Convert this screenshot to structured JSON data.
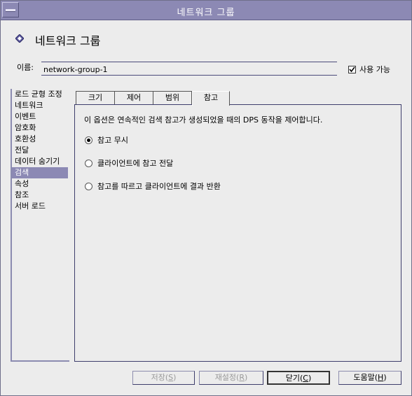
{
  "window": {
    "title": "네트워크 그룹"
  },
  "header": {
    "title": "네트워크 그룹",
    "icon": "diamond-icon"
  },
  "form": {
    "name_label": "이름:",
    "name_value": "network-group-1",
    "enable_label": "사용 가능",
    "enable_checked": true
  },
  "sidebar": {
    "items": [
      {
        "label": "로드 균형 조정"
      },
      {
        "label": "네트워크"
      },
      {
        "label": "이벤트"
      },
      {
        "label": "암호화"
      },
      {
        "label": "호환성"
      },
      {
        "label": "전달"
      },
      {
        "label": "데이터 숨기기"
      },
      {
        "label": "검색",
        "selected": true
      },
      {
        "label": "속성"
      },
      {
        "label": "참조"
      },
      {
        "label": "서버 로드"
      }
    ]
  },
  "tabs": [
    {
      "label": "크기"
    },
    {
      "label": "제어"
    },
    {
      "label": "범위"
    },
    {
      "label": "참고",
      "active": true
    }
  ],
  "panel": {
    "description": "이 옵션은 연속적인 검색 참고가 생성되었을 때의 DPS 동작을 제어합니다.",
    "options": [
      {
        "label": "참고 무시",
        "selected": true
      },
      {
        "label": "클라이언트에 참고 전달",
        "selected": false
      },
      {
        "label": "참고를 따르고 클라이언트에 결과 반환",
        "selected": false
      }
    ]
  },
  "buttons": {
    "save": {
      "label": "저장(S)",
      "text": "저장(",
      "mnemonic": "S",
      "close": ")",
      "enabled": false
    },
    "reset": {
      "label": "재설정(R)",
      "text": "재설정(",
      "mnemonic": "R",
      "close": ")",
      "enabled": false
    },
    "close": {
      "label": "닫기(C)",
      "text": "닫기(",
      "mnemonic": "C",
      "close": ")",
      "enabled": true
    },
    "help": {
      "label": "도움말(H)",
      "text": "도움말(",
      "mnemonic": "H",
      "close": ")",
      "enabled": true
    }
  },
  "colors": {
    "titlebar": "#8c89b4",
    "selection": "#8c89b4",
    "background": "#ececec",
    "border_dark": "#3e3e6c"
  }
}
